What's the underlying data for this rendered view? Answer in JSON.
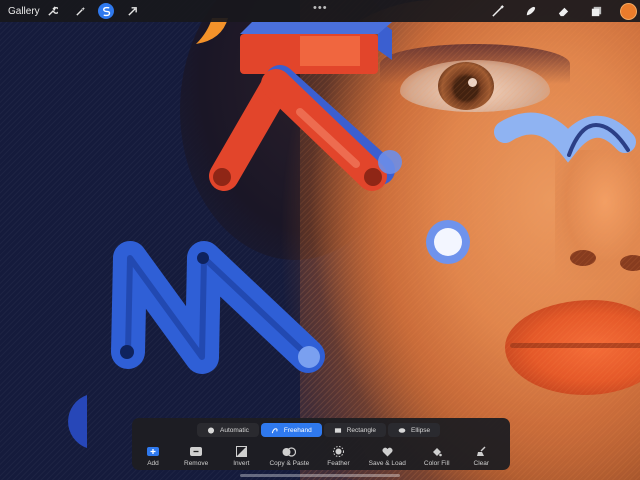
{
  "topbar": {
    "gallery_label": "Gallery",
    "left_tools": [
      {
        "name": "wrench-icon",
        "active": false
      },
      {
        "name": "magic-wand-icon",
        "active": false
      },
      {
        "name": "selection-icon",
        "active": true
      },
      {
        "name": "transform-arrow-icon",
        "active": false
      }
    ],
    "more_label": "•••",
    "right_tools": [
      "brush-icon",
      "smudge-icon",
      "eraser-icon",
      "layers-icon"
    ],
    "current_color": "#ea7c2b"
  },
  "selection_panel": {
    "modes": [
      {
        "label": "Automatic",
        "icon": "circle-icon",
        "selected": false
      },
      {
        "label": "Freehand",
        "icon": "freehand-icon",
        "selected": true
      },
      {
        "label": "Rectangle",
        "icon": "rectangle-icon",
        "selected": false
      },
      {
        "label": "Ellipse",
        "icon": "ellipse-icon",
        "selected": false
      }
    ],
    "actions": [
      {
        "label": "Add",
        "icon": "add-icon"
      },
      {
        "label": "Remove",
        "icon": "remove-icon"
      },
      {
        "label": "Invert",
        "icon": "invert-icon"
      },
      {
        "label": "Copy & Paste",
        "icon": "copy-paste-icon"
      },
      {
        "label": "Feather",
        "icon": "feather-icon"
      },
      {
        "label": "Save & Load",
        "icon": "save-load-icon"
      },
      {
        "label": "Color Fill",
        "icon": "color-fill-icon"
      },
      {
        "label": "Clear",
        "icon": "clear-icon"
      }
    ]
  },
  "colors": {
    "accent": "#2f79ee",
    "shape_red": "#e2452b",
    "shape_blue": "#2f5fd6",
    "shape_orange": "#f3922a"
  }
}
